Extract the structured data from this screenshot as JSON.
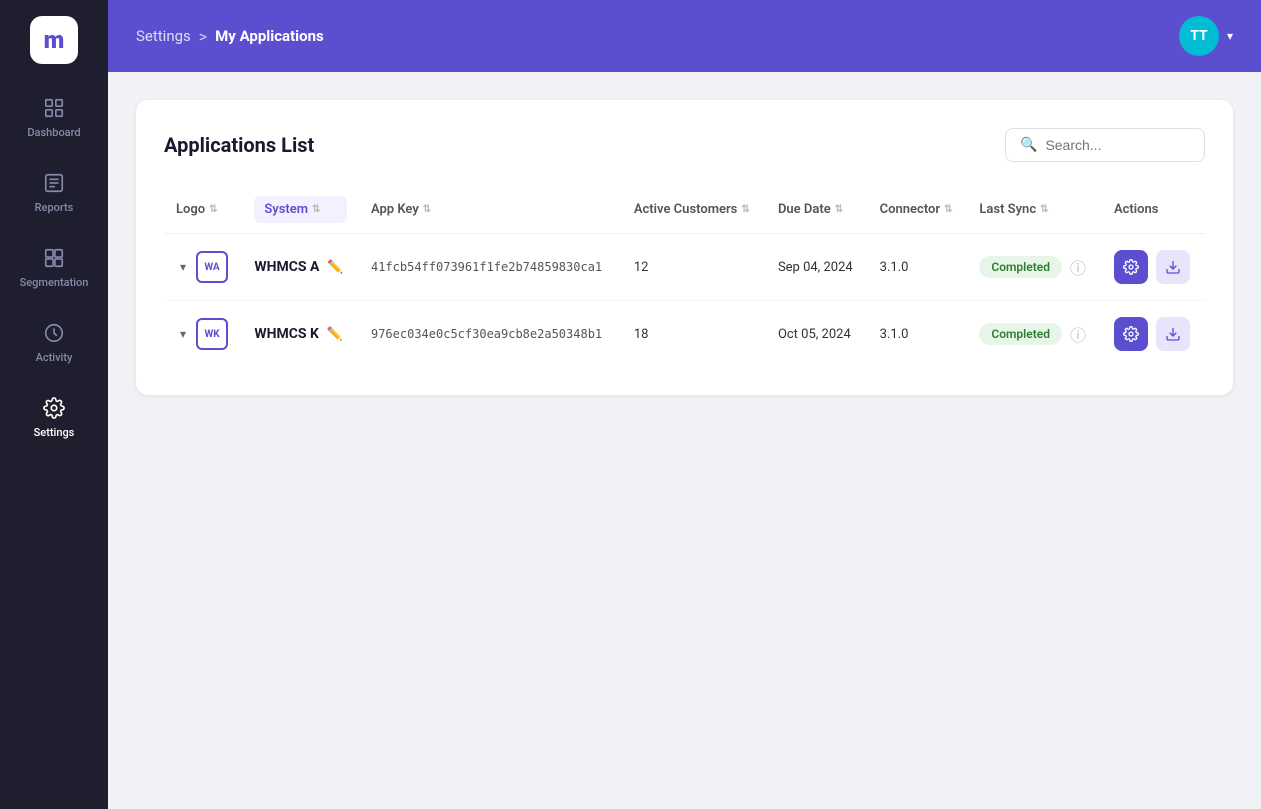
{
  "sidebar": {
    "logo": "m",
    "items": [
      {
        "id": "dashboard",
        "label": "Dashboard",
        "icon": "dashboard",
        "active": false
      },
      {
        "id": "reports",
        "label": "Reports",
        "icon": "reports",
        "active": false
      },
      {
        "id": "segmentation",
        "label": "Segmentation",
        "icon": "segmentation",
        "active": false
      },
      {
        "id": "activity",
        "label": "Activity",
        "icon": "activity",
        "active": false
      },
      {
        "id": "settings",
        "label": "Settings",
        "icon": "settings",
        "active": true
      }
    ]
  },
  "header": {
    "breadcrumb_parent": "Settings",
    "breadcrumb_separator": ">",
    "breadcrumb_current": "My Applications",
    "avatar_initials": "TT"
  },
  "page": {
    "title": "Applications List",
    "search_placeholder": "Search..."
  },
  "table": {
    "columns": [
      {
        "id": "logo",
        "label": "Logo"
      },
      {
        "id": "system",
        "label": "System",
        "active": true
      },
      {
        "id": "app_key",
        "label": "App Key"
      },
      {
        "id": "active_customers",
        "label": "Active Customers"
      },
      {
        "id": "due_date",
        "label": "Due Date"
      },
      {
        "id": "connector",
        "label": "Connector"
      },
      {
        "id": "last_sync",
        "label": "Last Sync"
      },
      {
        "id": "actions",
        "label": "Actions"
      }
    ],
    "rows": [
      {
        "id": 1,
        "badge": "WA",
        "system": "WHMCS A",
        "app_key": "41fcb54ff073961f1fe2b74859830ca1",
        "active_customers": "12",
        "due_date": "Sep 04, 2024",
        "connector": "3.1.0",
        "last_sync": "Completed",
        "status_color": "completed"
      },
      {
        "id": 2,
        "badge": "WK",
        "system": "WHMCS K",
        "app_key": "976ec034e0c5cf30ea9cb8e2a50348b1",
        "active_customers": "18",
        "due_date": "Oct 05, 2024",
        "connector": "3.1.0",
        "last_sync": "Completed",
        "status_color": "completed"
      }
    ]
  }
}
